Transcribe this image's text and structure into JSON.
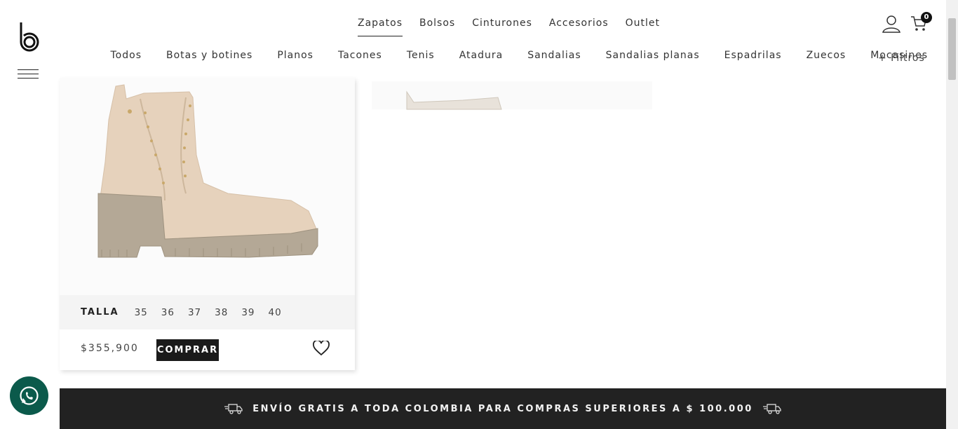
{
  "header": {
    "top_nav": [
      "Zapatos",
      "Bolsos",
      "Cinturones",
      "Accesorios",
      "Outlet"
    ],
    "active_top_nav": "Zapatos",
    "sub_nav": [
      "Todos",
      "Botas y botines",
      "Planos",
      "Tacones",
      "Tenis",
      "Atadura",
      "Sandalias",
      "Sandalias planas",
      "Espadrilas",
      "Zuecos",
      "Mocasines"
    ],
    "filters_label": "+ Filtros",
    "cart_count": "0"
  },
  "product": {
    "size_label": "TALLA",
    "sizes": [
      "35",
      "36",
      "37",
      "38",
      "39",
      "40"
    ],
    "price": "$355,900",
    "buy_label": "COMPRAR"
  },
  "promo": {
    "text": "ENVÍO GRATIS A TODA COLOMBIA PARA COMPRAS SUPERIORES A $ 100.000"
  },
  "icons": {
    "logo": "brand-b-logo",
    "menu": "hamburger-icon",
    "user": "user-icon",
    "cart": "cart-icon",
    "favorite": "heart-icon",
    "whatsapp": "whatsapp-icon",
    "truck": "truck-icon"
  },
  "colors": {
    "promo_bar": "#222222",
    "whatsapp": "#0b5a4b",
    "boot": "#e3cdb5"
  }
}
